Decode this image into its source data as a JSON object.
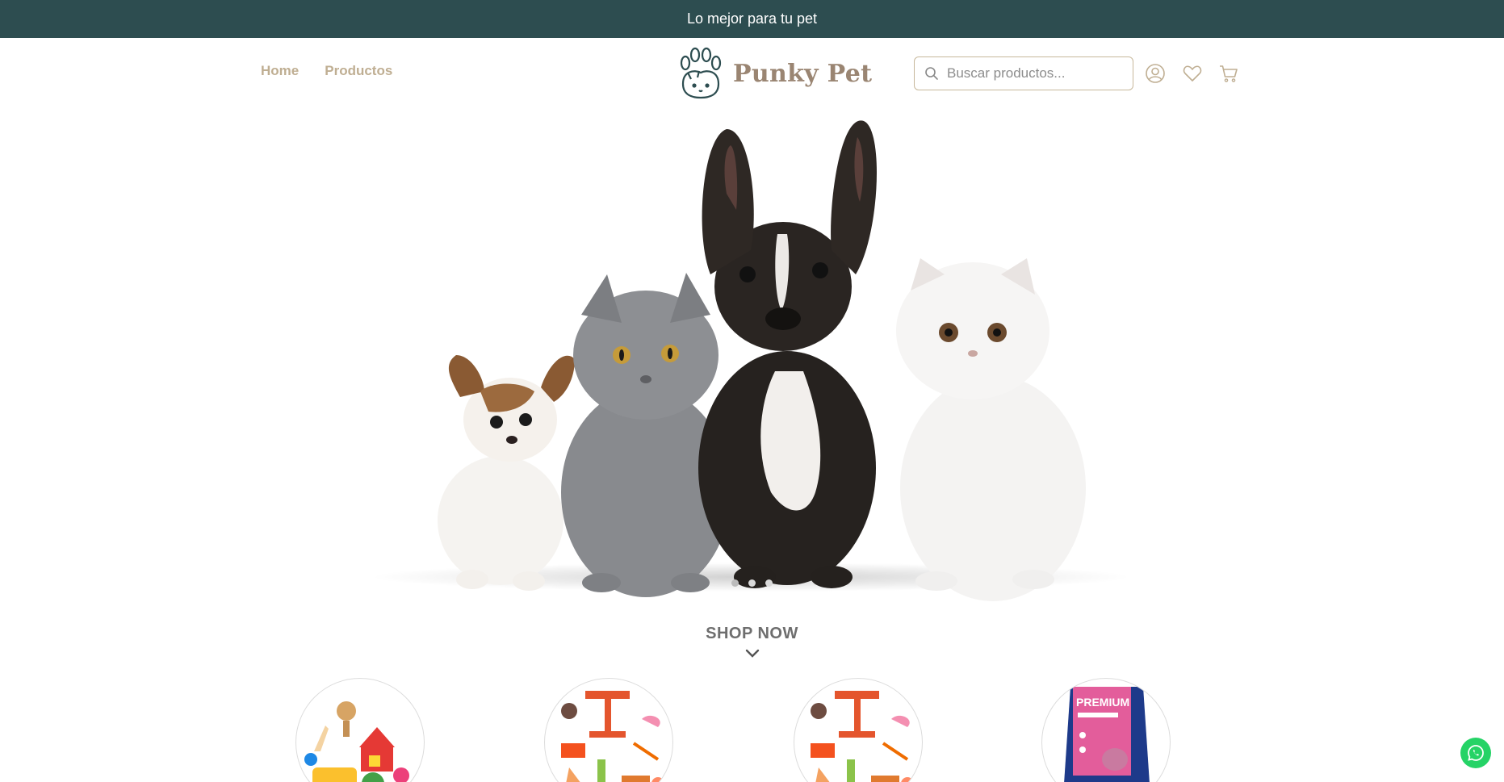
{
  "announcement": {
    "text": "Lo mejor para tu pet"
  },
  "nav": {
    "items": [
      {
        "label": "Home"
      },
      {
        "label": "Productos"
      }
    ]
  },
  "logo": {
    "text": "Punky Pet",
    "icon": "paw-pets-logo"
  },
  "search": {
    "placeholder": "Buscar productos..."
  },
  "header_icons": [
    "user-icon",
    "heart-icon",
    "cart-icon"
  ],
  "hero": {
    "slides": 3,
    "active_slide": 1,
    "image": "puppy-kitten-bulldog-kitten"
  },
  "shop_now": {
    "label": "SHOP NOW"
  },
  "categories": [
    {
      "image": "toys-icon"
    },
    {
      "image": "pet-accessories-icon"
    },
    {
      "image": "pet-accessories-icon"
    },
    {
      "image": "pet-food-bag-icon",
      "label": "PREMIUM"
    }
  ],
  "colors": {
    "announce_bg": "#2d4d50",
    "nav_link": "#bfae92",
    "logo_text": "#9a8572",
    "whatsapp": "#25d366"
  }
}
